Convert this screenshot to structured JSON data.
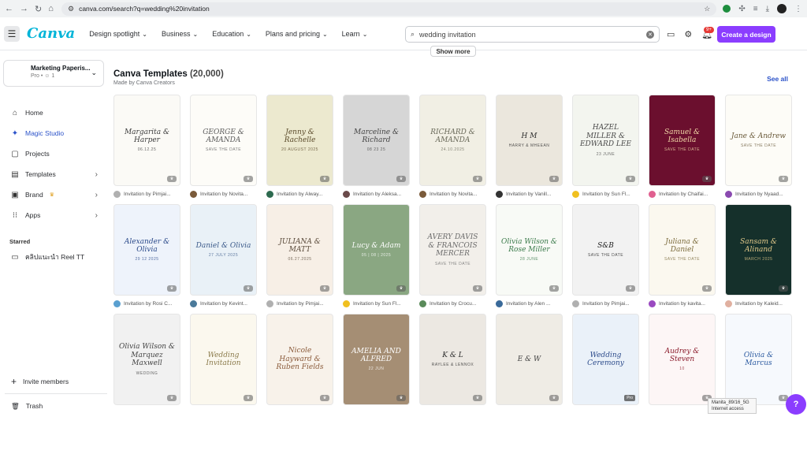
{
  "browser": {
    "url": "canva.com/search?q=wedding%20invitation"
  },
  "header": {
    "logo": "Canva",
    "nav": [
      {
        "label": "Design spotlight"
      },
      {
        "label": "Business"
      },
      {
        "label": "Education"
      },
      {
        "label": "Plans and pricing"
      },
      {
        "label": "Learn"
      }
    ],
    "search_value": "wedding invitation",
    "notification_count": "9+",
    "create_label": "Create a design"
  },
  "sidebar": {
    "team_name": "Marketing Paperis...",
    "team_sub": "Pro • ☺ 1",
    "items": [
      {
        "label": "Home",
        "icon": "home-icon"
      },
      {
        "label": "Magic Studio",
        "icon": "sparkle-icon"
      },
      {
        "label": "Projects",
        "icon": "folder-icon"
      },
      {
        "label": "Templates",
        "icon": "templates-icon"
      },
      {
        "label": "Brand",
        "icon": "brand-icon"
      },
      {
        "label": "Apps",
        "icon": "apps-icon"
      }
    ],
    "starred_title": "Starred",
    "starred_item": "คลิปแนะนำ Reel TT",
    "invite_label": "Invite members",
    "trash_label": "Trash"
  },
  "main": {
    "show_more": "Show more",
    "title": "Canva Templates",
    "count": "(20,000)",
    "subtitle": "Made by Canva Creators",
    "see_all": "See all",
    "templates": [
      {
        "text": "Margarita & Harper",
        "sub": "06.12.25",
        "creator": "Invitation by Pimjai...",
        "bg": "#fbfaf6",
        "fg": "#3d3d3d",
        "av": "#b0b0b0",
        "badge": "crown"
      },
      {
        "text": "GEORGE & AMANDA",
        "sub": "SAVE THE DATE",
        "creator": "Invitation by Novita...",
        "bg": "#fdfcf8",
        "fg": "#5a5a5a",
        "av": "#7a5a3a",
        "badge": "crown"
      },
      {
        "text": "Jenny & Rachelle",
        "sub": "20 AUGUST 2025",
        "creator": "Invitation by Alway...",
        "bg": "#ece9cf",
        "fg": "#5a4a2a",
        "av": "#2d6a4f",
        "badge": "crown"
      },
      {
        "text": "Marceline & Richard",
        "sub": "08 23 25",
        "creator": "Invitation by Aleksa...",
        "bg": "#d6d6d6",
        "fg": "#444",
        "av": "#6a4a4a",
        "badge": "crown"
      },
      {
        "text": "RICHARD & AMANDA",
        "sub": "24.10.2025",
        "creator": "Invitation by Novita...",
        "bg": "#f1efe4",
        "fg": "#6a6a5a",
        "av": "#7a5a3a",
        "badge": "crown"
      },
      {
        "text": "H M",
        "sub": "HARRY & MHEEAN",
        "creator": "Invitation by Vanill...",
        "bg": "#ebe7dd",
        "fg": "#2e2e2e",
        "av": "#333",
        "badge": "crown"
      },
      {
        "text": "HAZEL MILLER & EDWARD LEE",
        "sub": "23 JUNE",
        "creator": "Invitation by Sun Fl...",
        "bg": "#f3f5ef",
        "fg": "#4a4a4a",
        "av": "#f0c020",
        "badge": "crown"
      },
      {
        "text": "Samuel & Isabella",
        "sub": "SAVE THE DATE",
        "creator": "Invitation by Chaifai...",
        "bg": "#6b0f2e",
        "fg": "#f2d9a8",
        "av": "#e06090",
        "badge": "crown"
      },
      {
        "text": "Jane & Andrew",
        "sub": "SAVE THE DATE",
        "creator": "Invitation by Nyaad...",
        "bg": "#fdfcf7",
        "fg": "#6a5a3a",
        "av": "#8a4ab0",
        "badge": "crown"
      },
      {
        "text": "Alexander & Olivia",
        "sub": "29 12 2025",
        "creator": "Invitation by Rosi C...",
        "bg": "#eef3fb",
        "fg": "#2b4a8a",
        "av": "#5aa0d0",
        "badge": "crown"
      },
      {
        "text": "Daniel & Olivia",
        "sub": "27 JULY 2025",
        "creator": "Invitation by Kevint...",
        "bg": "#e9f1f7",
        "fg": "#3b5a8a",
        "av": "#4a7a9a",
        "badge": "crown"
      },
      {
        "text": "JULIANA & MATT",
        "sub": "06.27.2025",
        "creator": "Invitation by Pimjai...",
        "bg": "#f7efe6",
        "fg": "#5a4a3a",
        "av": "#b0b0b0",
        "badge": "crown"
      },
      {
        "text": "Lucy & Adam",
        "sub": "05 | 08 | 2025",
        "creator": "Invitation by Sun Fl...",
        "bg": "#8aa782",
        "fg": "#ffffff",
        "av": "#f0c020",
        "badge": "crown"
      },
      {
        "text": "AVERY DAVIS & FRANCOIS MERCER",
        "sub": "SAVE THE DATE",
        "creator": "Invitation by Crocu...",
        "bg": "#f2efea",
        "fg": "#6a6a6a",
        "av": "#5a8a5a",
        "badge": "crown"
      },
      {
        "text": "Olivia Wilson & Rose Miller",
        "sub": "28 JUNE",
        "creator": "Invitation by Alen ...",
        "bg": "#f8faf6",
        "fg": "#3a7a4a",
        "av": "#3a6a9a",
        "badge": "crown"
      },
      {
        "text": "S&B",
        "sub": "SAVE THE DATE",
        "creator": "Invitation by Pimjai...",
        "bg": "#f2f2f2",
        "fg": "#222",
        "av": "#b0b0b0",
        "badge": "crown"
      },
      {
        "text": "Juliana & Daniel",
        "sub": "SAVE THE DATE",
        "creator": "Invitation by kavita...",
        "bg": "#fbf8ef",
        "fg": "#7a6a3a",
        "av": "#9a4ac0",
        "badge": "crown"
      },
      {
        "text": "Sansam & Alinand",
        "sub": "MARCH 2025",
        "creator": "Invitation by Kaleid...",
        "bg": "#15302b",
        "fg": "#e2c98a",
        "av": "#e0b0a0",
        "badge": "crown"
      },
      {
        "text": "Olivia Wilson & Marquez Maxwell",
        "sub": "WEDDING",
        "creator": "",
        "bg": "#f1f1f1",
        "fg": "#444",
        "av": "#ffffff",
        "badge": "crown"
      },
      {
        "text": "Wedding Invitation",
        "sub": "",
        "creator": "",
        "bg": "#fbf8ee",
        "fg": "#8a7a4a",
        "av": "#ffffff",
        "badge": "crown"
      },
      {
        "text": "Nicole Hayward & Ruben Fields",
        "sub": "",
        "creator": "",
        "bg": "#f8f2ea",
        "fg": "#8a5a3a",
        "av": "#ffffff",
        "badge": "crown"
      },
      {
        "text": "AMELIA AND ALFRED",
        "sub": "22 JUN",
        "creator": "",
        "bg": "#a58e74",
        "fg": "#ffffff",
        "av": "#ffffff",
        "badge": "crown"
      },
      {
        "text": "K & L",
        "sub": "RAYLEE & LENNOX",
        "creator": "",
        "bg": "#ece8e2",
        "fg": "#2b2b2b",
        "av": "#ffffff",
        "badge": "crown"
      },
      {
        "text": "E & W",
        "sub": "",
        "creator": "",
        "bg": "#efece5",
        "fg": "#444",
        "av": "#ffffff",
        "badge": "crown"
      },
      {
        "text": "Wedding Ceremony",
        "sub": "",
        "creator": "",
        "bg": "#eaf1f9",
        "fg": "#2b4a8a",
        "av": "#ffffff",
        "badge": "pro"
      },
      {
        "text": "Audrey & Steven",
        "sub": "10",
        "creator": "",
        "bg": "#fdf6f6",
        "fg": "#8a1a2a",
        "av": "#ffffff",
        "badge": "crown"
      },
      {
        "text": "Olivia & Marcus",
        "sub": "",
        "creator": "",
        "bg": "#f6f9fd",
        "fg": "#2b5aa0",
        "av": "#ffffff",
        "badge": "crown"
      }
    ]
  },
  "tooltip": {
    "line1": "Manita_89/16_5G",
    "line2": "Internet access"
  },
  "help_label": "?"
}
